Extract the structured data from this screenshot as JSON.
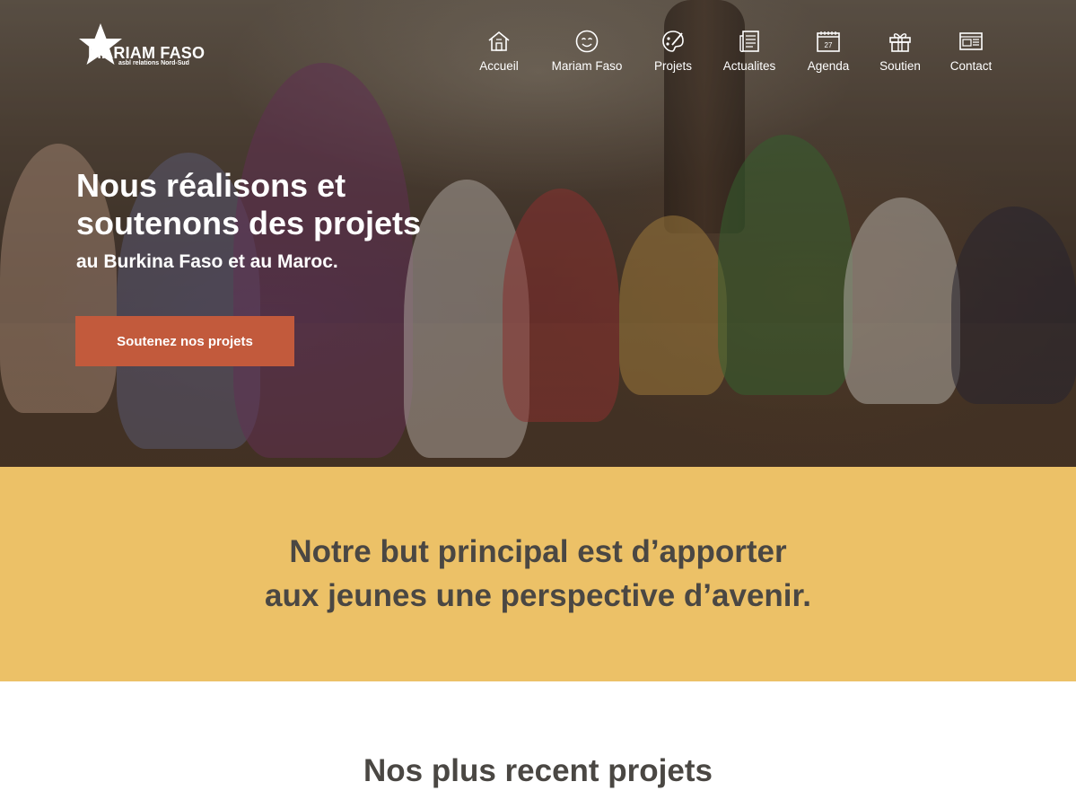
{
  "logo": {
    "title": "MARIAM FASO",
    "subtitle": "asbl relations Nord-Sud"
  },
  "nav": {
    "items": [
      {
        "label": "Accueil",
        "icon": "house-icon"
      },
      {
        "label": "Mariam Faso",
        "icon": "smiley-icon"
      },
      {
        "label": "Projets",
        "icon": "palette-icon"
      },
      {
        "label": "Actualites",
        "icon": "newspaper-icon"
      },
      {
        "label": "Agenda",
        "icon": "calendar-icon",
        "icon_text": "27"
      },
      {
        "label": "Soutien",
        "icon": "gift-icon"
      },
      {
        "label": "Contact",
        "icon": "browser-window-icon"
      }
    ]
  },
  "hero": {
    "title": "Nous réalisons et soutenons des projets",
    "subtitle": "au Burkina Faso et au Maroc.",
    "cta_label": "Soutenez nos projets"
  },
  "mission": {
    "line1": "Notre but principal est d’apporter",
    "line2": "aux jeunes une perspective d’avenir."
  },
  "recent": {
    "title": "Nos plus recent projets"
  },
  "colors": {
    "accent_button": "#c25a3c",
    "mission_band": "#ecc167",
    "heading_text": "#4a4743"
  }
}
